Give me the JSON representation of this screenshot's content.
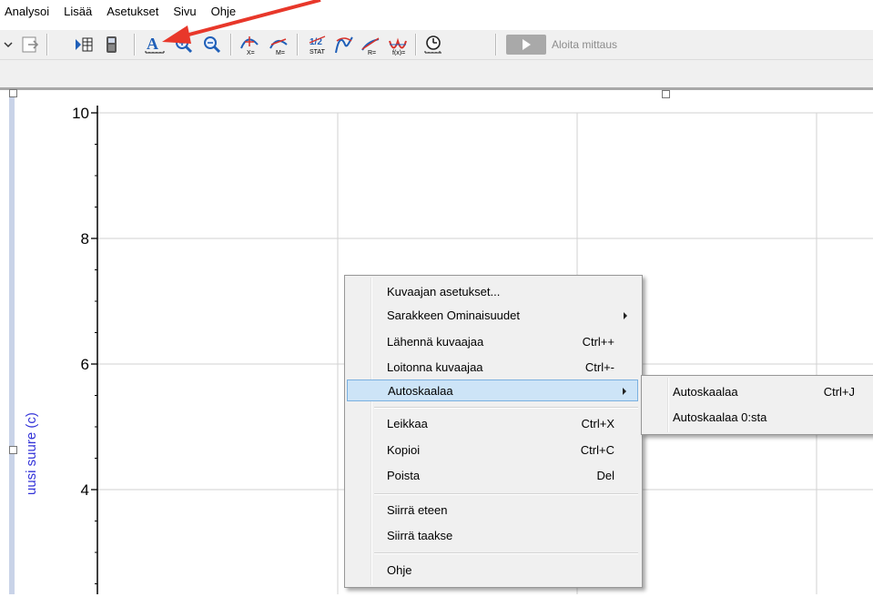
{
  "menubar": {
    "items": [
      "Analysoi",
      "Lisää",
      "Asetukset",
      "Sivu",
      "Ohje"
    ]
  },
  "toolbar": {
    "start_label": "Aloita mittaus",
    "tools": [
      "dropdown-chevron-icon",
      "import-arrow-icon",
      "data-browser-icon",
      "device-icon",
      "autoscale-icon",
      "zoom-in-icon",
      "zoom-out-icon",
      "examine-icon",
      "tangent-icon",
      "statistics-icon",
      "curve-fit-icon",
      "linear-fit-icon",
      "integral-fit-icon",
      "function-fit-icon",
      "timer-icon"
    ]
  },
  "graph": {
    "ylabel": "uusi suure (c)",
    "yticks": [
      "10",
      "8",
      "6",
      "4"
    ],
    "axis_color": "#000000",
    "label_color": "#3232d8"
  },
  "context_menu": {
    "items": [
      {
        "label": "Kuvaajan asetukset...",
        "shortcut": ""
      },
      {
        "label": "Sarakkeen Ominaisuudet",
        "shortcut": "",
        "submenu": true
      },
      {
        "label": "Lähennä kuvaajaa",
        "shortcut": "Ctrl++"
      },
      {
        "label": "Loitonna kuvaajaa",
        "shortcut": "Ctrl+-"
      },
      {
        "label": "Autoskaalaa",
        "shortcut": "",
        "submenu": true,
        "highlighted": true
      },
      {
        "label": "Leikkaa",
        "shortcut": "Ctrl+X"
      },
      {
        "label": "Kopioi",
        "shortcut": "Ctrl+C"
      },
      {
        "label": "Poista",
        "shortcut": "Del"
      },
      {
        "label": "Siirrä eteen",
        "shortcut": ""
      },
      {
        "label": "Siirrä taakse",
        "shortcut": ""
      },
      {
        "label": "Ohje",
        "shortcut": ""
      }
    ],
    "highlight_color": "#cde4f7"
  },
  "submenu": {
    "items": [
      {
        "label": "Autoskaalaa",
        "shortcut": "Ctrl+J"
      },
      {
        "label": "Autoskaalaa 0:sta",
        "shortcut": ""
      }
    ]
  },
  "annotation": {
    "arrow_color": "#e8372a"
  }
}
